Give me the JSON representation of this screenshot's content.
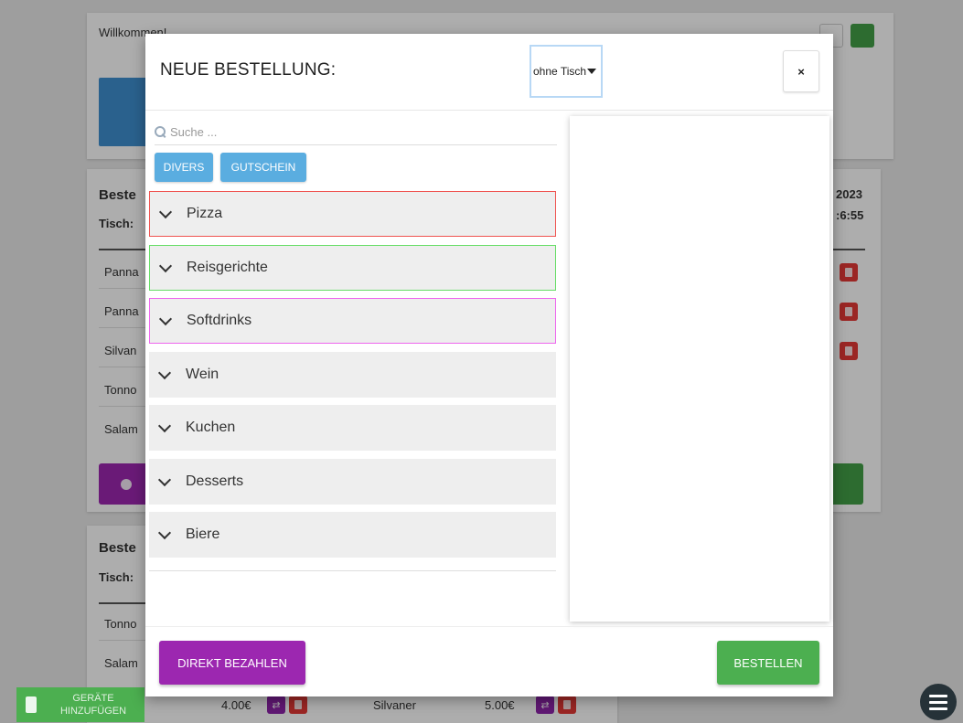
{
  "background": {
    "welcome": "Willkommen!",
    "order_label": "Beste",
    "table_label": "Tisch:",
    "date_fragment": "2023",
    "time_fragment": ":6:55",
    "items": [
      "Panna",
      "Panna",
      "Silvan",
      "Tonno",
      "Salam"
    ],
    "lower_items": [
      "Tonno",
      "Salam"
    ],
    "bottom_price_1": "4.00€",
    "bottom_item": "Silvaner",
    "bottom_price_2": "5.00€",
    "add_device_label": "GERÄTE HINZUFÜGEN",
    "colors": {
      "blue": "#3f8fd0",
      "purple": "#9c27b0",
      "green": "#43a047",
      "red": "#e53935"
    }
  },
  "modal": {
    "title": "NEUE BESTELLUNG:",
    "table_select": {
      "value": "ohne Tisch"
    },
    "close_label": "×",
    "search": {
      "placeholder": "Suche ..."
    },
    "quick_buttons": [
      {
        "label": "DIVERS"
      },
      {
        "label": "GUTSCHEIN"
      }
    ],
    "categories": [
      {
        "label": "Pizza",
        "border": "#ef5350"
      },
      {
        "label": "Reisgerichte",
        "border": "#66dd66"
      },
      {
        "label": "Softdrinks",
        "border": "#ee66ee"
      },
      {
        "label": "Wein",
        "border": ""
      },
      {
        "label": "Kuchen",
        "border": ""
      },
      {
        "label": "Desserts",
        "border": ""
      },
      {
        "label": "Biere",
        "border": ""
      }
    ],
    "footer": {
      "pay_label": "DIREKT BEZAHLEN",
      "order_label": "BESTELLEN"
    }
  }
}
